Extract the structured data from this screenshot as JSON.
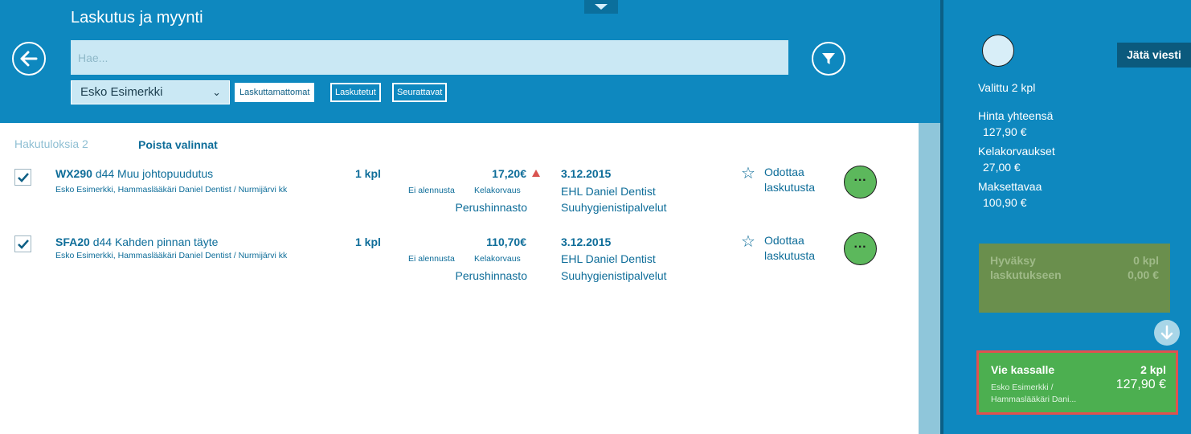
{
  "header": {
    "title": "Laskutus ja myynti",
    "search_placeholder": "Hae...",
    "customer_select": "Esko Esimerkki",
    "filters": [
      "Laskuttamattomat",
      "Laskutetut",
      "Seurattavat"
    ]
  },
  "results": {
    "count_label": "Hakutuloksia 2",
    "clear_label": "Poista valinnat"
  },
  "rows": [
    {
      "code": "WX290",
      "description": "d44 Muu johtopuudutus",
      "patient": "Esko Esimerkki, Hammaslääkäri Daniel Dentist / Nurmijärvi kk",
      "qty": "1 kpl",
      "price": "17,20€",
      "discount": "Ei alennusta",
      "kela": "Kelakorvaus",
      "tariff": "Perushinnasto",
      "date": "3.12.2015",
      "provider": "EHL Daniel Dentist",
      "service": "Suuhygienistipalvelut",
      "status_line1": "Odottaa",
      "status_line2": "laskutusta",
      "more": "···",
      "warning": true
    },
    {
      "code": "SFA20",
      "description": "d44 Kahden pinnan täyte",
      "patient": "Esko Esimerkki, Hammaslääkäri Daniel Dentist / Nurmijärvi kk",
      "qty": "1 kpl",
      "price": "110,70€",
      "discount": "Ei alennusta",
      "kela": "Kelakorvaus",
      "tariff": "Perushinnasto",
      "date": "3.12.2015",
      "provider": "EHL Daniel Dentist",
      "service": "Suuhygienistipalvelut",
      "status_line1": "Odottaa",
      "status_line2": "laskutusta",
      "more": "···",
      "warning": false
    }
  ],
  "side": {
    "leave_message": "Jätä viesti",
    "selected": "Valittu 2 kpl",
    "total_label": "Hinta yhteensä",
    "total_value": "127,90 €",
    "kela_label": "Kelakorvaukset",
    "kela_value": "27,00 €",
    "payable_label": "Maksettavaa",
    "payable_value": "100,90 €",
    "approve": {
      "line1": "Hyväksy",
      "line2": "laskutukseen",
      "qty": "0 kpl",
      "amount": "0,00 €"
    },
    "checkout": {
      "title": "Vie kassalle",
      "qty": "2 kpl",
      "total": "127,90 €",
      "sub1": "Esko Esimerkki /",
      "sub2": "Hammaslääkäri Dani..."
    }
  },
  "colors": {
    "header_bg": "#0e88bf",
    "text_blue": "#0e6d99",
    "checkout_green": "#4caf50",
    "checkout_border": "#e0514f"
  }
}
